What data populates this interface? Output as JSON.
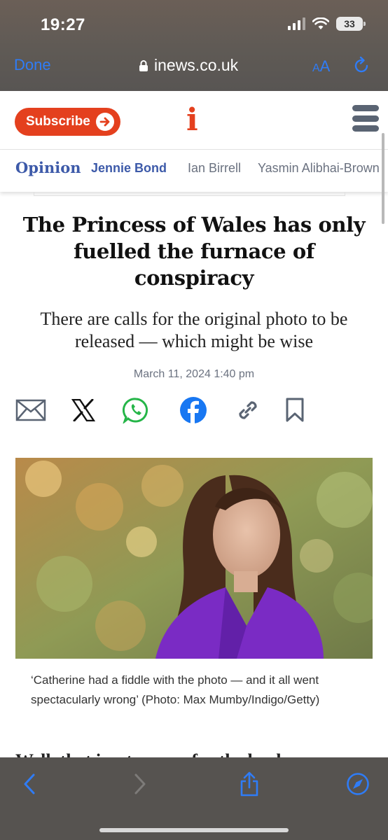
{
  "status_bar": {
    "time": "19:27",
    "battery": "33"
  },
  "browser": {
    "done_label": "Done",
    "url": "inews.co.uk",
    "reader_label_small": "A",
    "reader_label_large": "A",
    "accent_color": "#2f7cf6"
  },
  "site_header": {
    "subscribe_label": "Subscribe",
    "logo": "i",
    "brand_color": "#e4401e"
  },
  "section_nav": {
    "section": "Opinion",
    "items": [
      {
        "label": "Jennie Bond",
        "active": true
      },
      {
        "label": "Ian Birrell",
        "active": false
      },
      {
        "label": "Yasmin Alibhai-Brown",
        "active": false
      }
    ]
  },
  "article": {
    "headline": "The Princess of Wales has only fuelled the furnace of conspiracy",
    "subheadline": "There are calls for the original photo to be released — which might be wise",
    "date": "March 11, 2024 1:40 pm",
    "share_icons": [
      "email-icon",
      "x-icon",
      "whatsapp-icon",
      "facebook-icon",
      "link-icon",
      "bookmark-icon"
    ],
    "caption": "‘Catherine had a fiddle with the photo — and it all went spectacularly wrong’ (Photo: Max Mumby/Indigo/Getty)",
    "body_peek": "Well, that is a turn-up for the book."
  },
  "toolbar": {
    "icons": [
      "back-icon",
      "forward-icon",
      "share-icon",
      "compass-icon"
    ]
  }
}
